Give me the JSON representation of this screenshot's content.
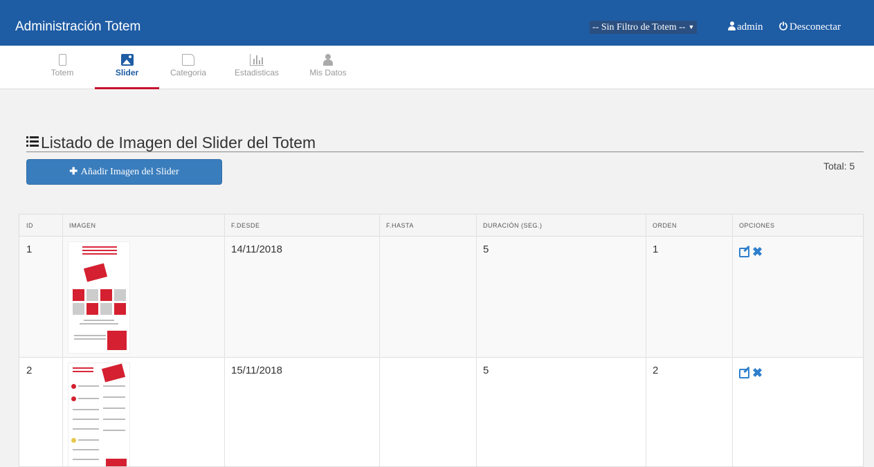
{
  "app": {
    "title": "Administración Totem",
    "filter_label": "-- Sin Filtro de Totem --",
    "user_label": "admin",
    "logout_label": "Desconectar"
  },
  "tabs": [
    {
      "label": "Totem",
      "icon": "mobile-icon",
      "active": false
    },
    {
      "label": "Slider",
      "icon": "image-icon",
      "active": true
    },
    {
      "label": "Categoria",
      "icon": "folder-icon",
      "active": false
    },
    {
      "label": "Estadisticas",
      "icon": "bar-chart-icon",
      "active": false
    },
    {
      "label": "Mis Datos",
      "icon": "user-icon",
      "active": false
    }
  ],
  "page": {
    "title": "Listado de Imagen del Slider del Totem",
    "add_button_label": "Añadir Imagen del Slider",
    "total_label": "Total: 5"
  },
  "table": {
    "headers": [
      "ID",
      "IMAGEN",
      "F.DESDE",
      "F.HASTA",
      "DURACIÓN (SEG.)",
      "ORDEN",
      "OPCIONES"
    ],
    "rows": [
      {
        "id": "1",
        "f_desde": "14/11/2018",
        "f_hasta": "",
        "duracion": "5",
        "orden": "1"
      },
      {
        "id": "2",
        "f_desde": "15/11/2018",
        "f_hasta": "",
        "duracion": "5",
        "orden": "2"
      }
    ]
  },
  "colors": {
    "navbar": "#1e5ca4",
    "accent_tab": "#c8102e",
    "button": "#3a7dbd",
    "option_icons": "#2e7fcc"
  }
}
